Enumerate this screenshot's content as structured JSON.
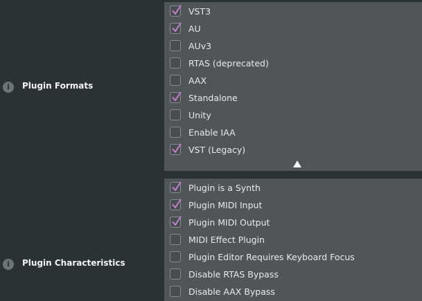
{
  "plugin_formats": {
    "label": "Plugin Formats",
    "info_icon": "info-icon",
    "options": [
      {
        "label": "VST3",
        "checked": true
      },
      {
        "label": "AU",
        "checked": true
      },
      {
        "label": "AUv3",
        "checked": false
      },
      {
        "label": "RTAS (deprecated)",
        "checked": false
      },
      {
        "label": "AAX",
        "checked": false
      },
      {
        "label": "Standalone",
        "checked": true
      },
      {
        "label": "Unity",
        "checked": false
      },
      {
        "label": "Enable IAA",
        "checked": false
      },
      {
        "label": "VST (Legacy)",
        "checked": true
      }
    ],
    "scroll_icon": "triangle-up-icon"
  },
  "plugin_characteristics": {
    "label": "Plugin Characteristics",
    "info_icon": "info-icon",
    "options": [
      {
        "label": "Plugin is a Synth",
        "checked": true
      },
      {
        "label": "Plugin MIDI Input",
        "checked": true
      },
      {
        "label": "Plugin MIDI Output",
        "checked": true
      },
      {
        "label": "MIDI Effect Plugin",
        "checked": false
      },
      {
        "label": "Plugin Editor Requires Keyboard Focus",
        "checked": false
      },
      {
        "label": "Disable RTAS Bypass",
        "checked": false
      },
      {
        "label": "Disable AAX Bypass",
        "checked": false
      }
    ]
  },
  "colors": {
    "background": "#2b3236",
    "panel": "#4f5558",
    "checkmark": "#c77fcf",
    "text": "#e8ebed"
  }
}
